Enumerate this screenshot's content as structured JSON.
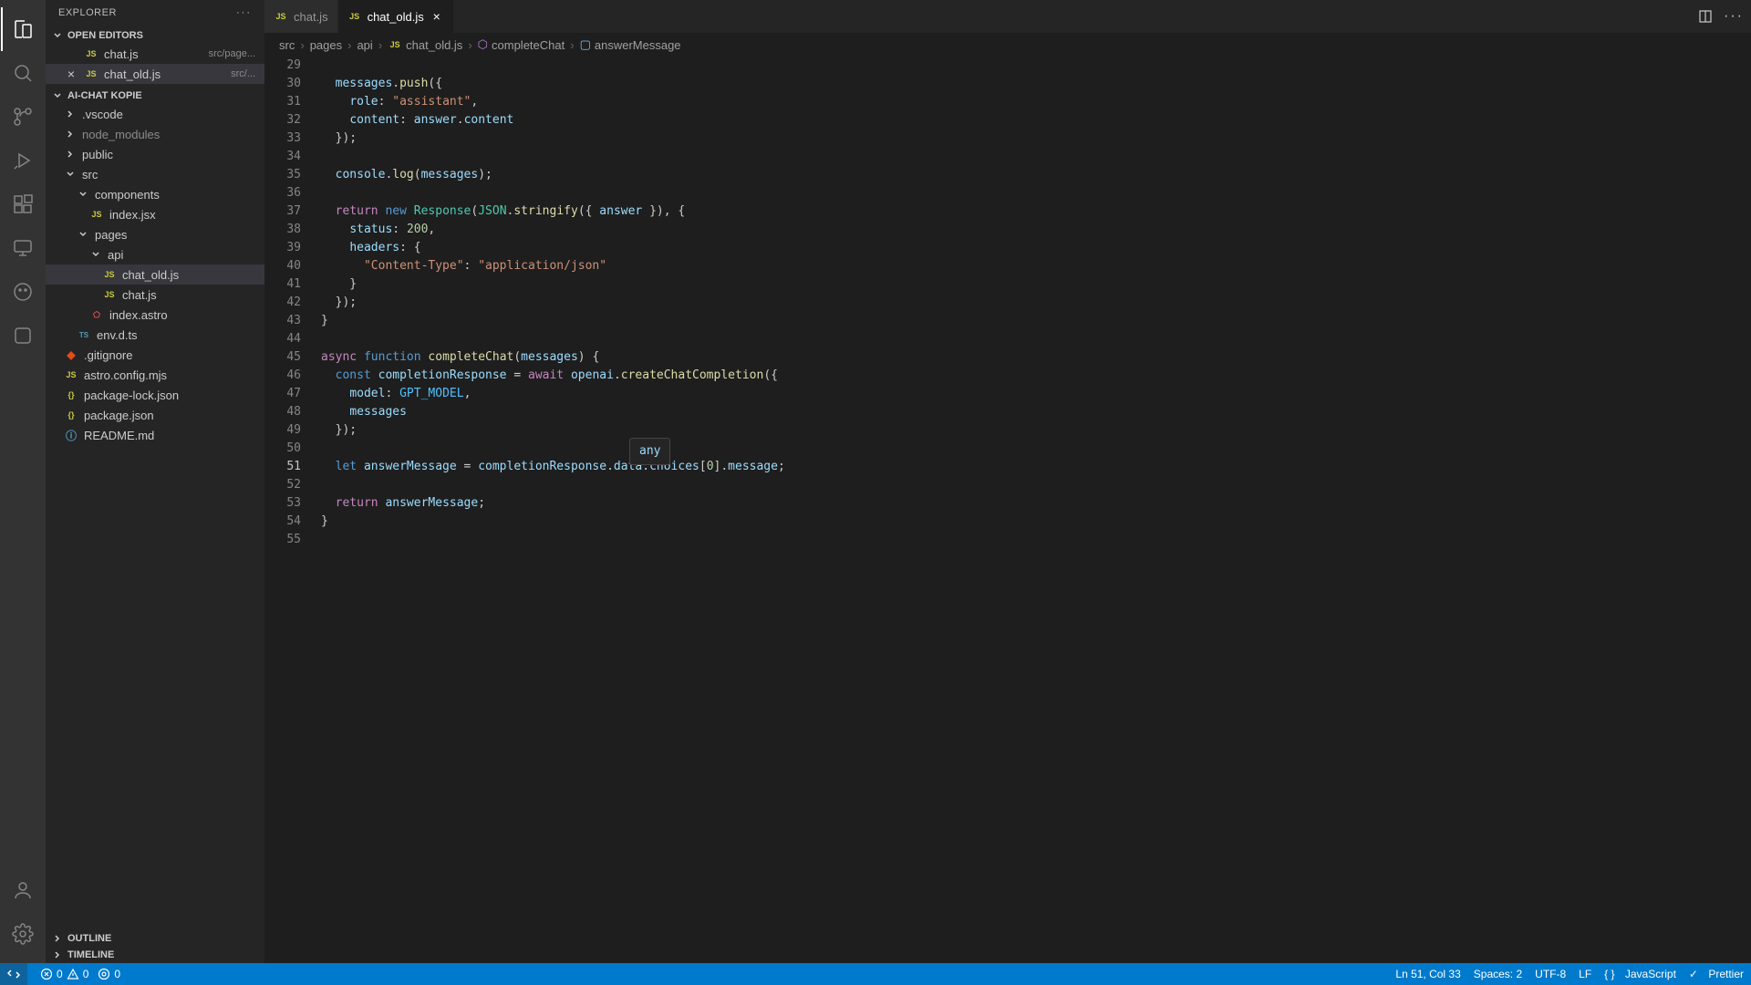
{
  "sidebar": {
    "title": "EXPLORER",
    "openEditors": {
      "label": "OPEN EDITORS",
      "items": [
        {
          "name": "chat.js",
          "hint": "src/page..."
        },
        {
          "name": "chat_old.js",
          "hint": "src/..."
        }
      ]
    },
    "project": {
      "label": "AI-CHAT KOPIE",
      "tree": {
        "vscode": ".vscode",
        "node_modules": "node_modules",
        "public": "public",
        "src": "src",
        "components": "components",
        "index_jsx": "index.jsx",
        "pages": "pages",
        "api": "api",
        "chat_old": "chat_old.js",
        "chat": "chat.js",
        "index_astro": "index.astro",
        "env_d_ts": "env.d.ts",
        "gitignore": ".gitignore",
        "astro_config": "astro.config.mjs",
        "package_lock": "package-lock.json",
        "package_json": "package.json",
        "readme": "README.md"
      }
    },
    "outline": "OUTLINE",
    "timeline": "TIMELINE"
  },
  "tabs": {
    "chat": "chat.js",
    "chat_old": "chat_old.js"
  },
  "breadcrumb": {
    "src": "src",
    "pages": "pages",
    "api": "api",
    "file": "chat_old.js",
    "fn1": "completeChat",
    "fn2": "answerMessage"
  },
  "editor": {
    "startLine": 29,
    "hoverTip": "any",
    "lines": [
      "",
      "  messages.push({",
      "    role: \"assistant\",",
      "    content: answer.content",
      "  });",
      "",
      "  console.log(messages);",
      "",
      "  return new Response(JSON.stringify({ answer }), {",
      "    status: 200,",
      "    headers: {",
      "      \"Content-Type\": \"application/json\"",
      "    }",
      "  });",
      "}",
      "",
      "async function completeChat(messages) {",
      "  const completionResponse = await openai.createChatCompletion({",
      "    model: GPT_MODEL,",
      "    messages",
      "  });",
      "",
      "  let answerMessage = completionResponse.data.choices[0].message;",
      "",
      "  return answerMessage;",
      "}",
      ""
    ]
  },
  "status": {
    "errors": "0",
    "warnings": "0",
    "cursor": "Ln 51, Col 33",
    "spaces": "Spaces: 2",
    "encoding": "UTF-8",
    "eol": "LF",
    "lang": "JavaScript",
    "prettier": "Prettier"
  }
}
